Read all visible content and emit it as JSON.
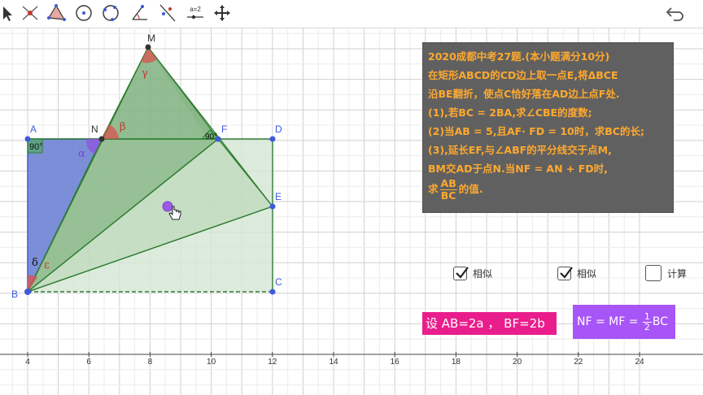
{
  "toolbar": {
    "tools": [
      {
        "icon": "move-arrow-icon"
      },
      {
        "icon": "point-tool-icon"
      },
      {
        "icon": "polygon-tool-icon"
      },
      {
        "icon": "circle-center-point-icon"
      },
      {
        "icon": "circle-three-points-icon"
      },
      {
        "icon": "angle-tool-icon"
      },
      {
        "icon": "reflect-line-icon"
      },
      {
        "icon": "slider-tool-icon",
        "label": "a=2"
      },
      {
        "icon": "move-graphics-view-icon"
      }
    ],
    "undo_icon": "undo-icon"
  },
  "geometry": {
    "points": {
      "A": "A",
      "B": "B",
      "C": "C",
      "D": "D",
      "E": "E",
      "F": "F",
      "M": "M",
      "N": "N"
    },
    "angle_labels": {
      "a90": "90°",
      "f90": "90°",
      "alpha": "α",
      "beta": "β",
      "gamma": "γ",
      "delta": "δ",
      "epsilon": "ε"
    },
    "x_axis_ticks": [
      "4",
      "6",
      "8",
      "10",
      "12",
      "14",
      "16",
      "18",
      "20",
      "22",
      "24"
    ],
    "colors": {
      "rect_blue": "#5a6fd6",
      "fold_green": "#2e7d32",
      "point_blue": "#3f5bd9",
      "angle_red": "#c0392b",
      "angle_purple": "#7b3fd4"
    }
  },
  "problem": {
    "line1": "2020成都中考27题.(本小题满分10分)",
    "line2": "在矩形ABCD的CD边上取一点E,将ΔBCE",
    "line3": "沿BE翻折，使点C恰好落在AD边上点F处.",
    "line4": "(1),若BC = 2BA,求∠CBE的度数;",
    "line5": "(2)当AB = 5,且AF· FD = 10时，求BC的长;",
    "line6": "(3),延长EF,与∠ABF的平分线交于点M,",
    "line7": "BM交AD于点N.当NF = AN + FD时,",
    "line8_prefix": "求",
    "line8_num": "AB",
    "line8_den": "BC",
    "line8_suffix": "的值."
  },
  "checkboxes": [
    {
      "label": "相似",
      "checked": true
    },
    {
      "label": "相似",
      "checked": true
    },
    {
      "label": "计算",
      "checked": false
    }
  ],
  "set_box": {
    "text": "设 AB=2a  ，  BF=2b"
  },
  "nf_box": {
    "prefix": "NF = MF =",
    "num": "1",
    "den": "2",
    "suffix": "BC"
  }
}
